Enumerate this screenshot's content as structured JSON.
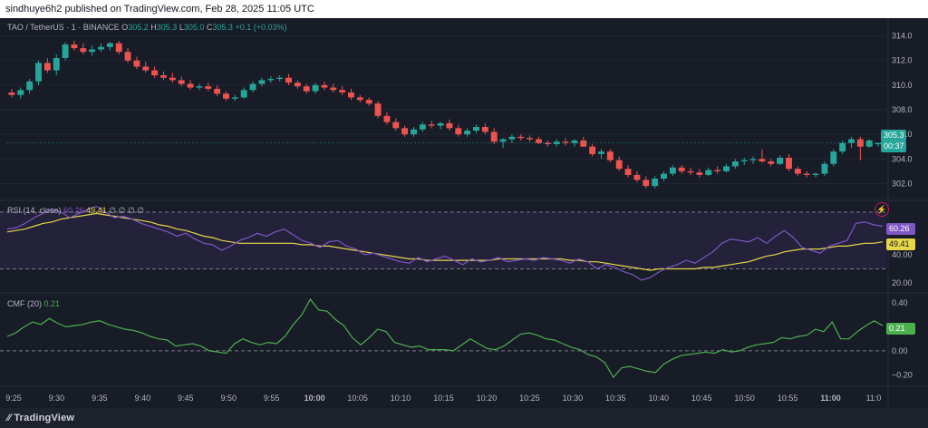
{
  "header": {
    "published_text": "sindhuye6h2 published on TradingView.com, Feb 28, 2025 11:05 UTC"
  },
  "legend": {
    "symbol": "TAO / TetherUS · 1 · BINANCE",
    "open_label": "O",
    "open": "305.2",
    "high_label": "H",
    "high": "305.3",
    "low_label": "L",
    "low": "305.0",
    "close_label": "C",
    "close": "305.3",
    "change": "+0.1 (+0.03%)"
  },
  "price_tags": {
    "price": "305.3",
    "countdown": "00:37"
  },
  "rsi_legend": {
    "label": "RSI (14, close)",
    "rsi": "60.26",
    "ma": "49.41",
    "extra": "∅ ∅ ∅ ∅"
  },
  "rsi_tags": {
    "rsi": "60.26",
    "ma": "49.41"
  },
  "cmf_legend": {
    "label": "CMF (20)",
    "value": "0.21"
  },
  "cmf_tag": {
    "value": "0.21"
  },
  "footer": {
    "brand": "TradingView"
  },
  "colors": {
    "up": "#26a69a",
    "down": "#ef5350",
    "rsi": "#7e57c2",
    "rsi_ma": "#e6d64a",
    "cmf": "#4caf50",
    "band": "#2a2445"
  },
  "chart_data": [
    {
      "type": "candlestick",
      "title": "TAO / TetherUS · 1 · BINANCE",
      "ylim": [
        301,
        315
      ],
      "yticks": [
        302.0,
        304.0,
        306.0,
        308.0,
        310.0,
        312.0,
        314.0
      ],
      "xticks": [
        "9:25",
        "9:30",
        "9:35",
        "9:40",
        "9:45",
        "9:50",
        "9:55",
        "10:00",
        "10:05",
        "10:10",
        "10:15",
        "10:20",
        "10:25",
        "10:30",
        "10:35",
        "10:40",
        "10:45",
        "10:50",
        "10:55",
        "11:00",
        "11:0"
      ],
      "candles": [
        [
          309.4,
          309.7,
          309.0,
          309.2
        ],
        [
          309.2,
          309.8,
          308.9,
          309.6
        ],
        [
          309.6,
          310.5,
          309.3,
          310.3
        ],
        [
          310.3,
          312.0,
          310.0,
          311.8
        ],
        [
          311.8,
          312.2,
          311.0,
          311.2
        ],
        [
          311.2,
          312.5,
          310.8,
          312.2
        ],
        [
          312.2,
          313.5,
          312.0,
          313.3
        ],
        [
          313.3,
          313.6,
          312.8,
          313.0
        ],
        [
          313.0,
          313.4,
          312.5,
          312.7
        ],
        [
          312.7,
          313.2,
          312.4,
          312.9
        ],
        [
          312.9,
          313.4,
          312.7,
          313.1
        ],
        [
          313.1,
          313.5,
          312.8,
          313.4
        ],
        [
          313.4,
          313.6,
          312.5,
          312.7
        ],
        [
          312.7,
          313.0,
          311.8,
          312.0
        ],
        [
          312.0,
          312.3,
          311.3,
          311.5
        ],
        [
          311.5,
          311.9,
          311.0,
          311.2
        ],
        [
          311.2,
          311.5,
          310.6,
          310.8
        ],
        [
          310.8,
          311.1,
          310.4,
          310.6
        ],
        [
          310.6,
          311.0,
          310.2,
          310.4
        ],
        [
          310.4,
          310.7,
          309.9,
          310.1
        ],
        [
          310.1,
          310.4,
          309.6,
          309.8
        ],
        [
          309.8,
          310.1,
          309.6,
          309.9
        ],
        [
          309.9,
          310.2,
          309.5,
          309.7
        ],
        [
          309.7,
          310.0,
          309.1,
          309.3
        ],
        [
          309.3,
          309.5,
          308.7,
          308.9
        ],
        [
          308.9,
          309.2,
          308.7,
          309.0
        ],
        [
          309.0,
          309.8,
          308.9,
          309.6
        ],
        [
          309.6,
          310.3,
          309.4,
          310.1
        ],
        [
          310.1,
          310.6,
          309.9,
          310.4
        ],
        [
          310.4,
          310.7,
          310.2,
          310.5
        ],
        [
          310.5,
          310.8,
          310.3,
          310.6
        ],
        [
          310.6,
          310.9,
          310.0,
          310.2
        ],
        [
          310.2,
          310.4,
          309.7,
          309.9
        ],
        [
          309.9,
          310.1,
          309.3,
          309.5
        ],
        [
          309.5,
          310.2,
          309.3,
          310.0
        ],
        [
          310.0,
          310.3,
          309.6,
          309.8
        ],
        [
          309.8,
          310.1,
          309.4,
          309.6
        ],
        [
          309.6,
          309.9,
          309.2,
          309.4
        ],
        [
          309.4,
          309.7,
          308.8,
          309.0
        ],
        [
          309.0,
          309.2,
          308.6,
          308.8
        ],
        [
          308.8,
          309.0,
          308.3,
          308.5
        ],
        [
          308.5,
          308.7,
          307.3,
          307.5
        ],
        [
          307.5,
          307.8,
          306.8,
          307.0
        ],
        [
          307.0,
          307.3,
          306.3,
          306.5
        ],
        [
          306.5,
          306.7,
          305.8,
          306.0
        ],
        [
          306.0,
          306.6,
          305.8,
          306.4
        ],
        [
          306.4,
          307.0,
          306.2,
          306.8
        ],
        [
          306.8,
          307.1,
          306.5,
          306.7
        ],
        [
          306.7,
          307.0,
          306.4,
          306.9
        ],
        [
          306.9,
          307.2,
          306.3,
          306.5
        ],
        [
          306.5,
          306.8,
          305.8,
          306.0
        ],
        [
          306.0,
          306.5,
          305.8,
          306.3
        ],
        [
          306.3,
          306.8,
          306.1,
          306.6
        ],
        [
          306.6,
          306.9,
          306.0,
          306.2
        ],
        [
          306.2,
          306.5,
          305.2,
          305.4
        ],
        [
          305.4,
          305.7,
          304.9,
          305.6
        ],
        [
          305.6,
          306.0,
          305.3,
          305.8
        ],
        [
          305.8,
          306.0,
          305.5,
          305.7
        ],
        [
          305.7,
          305.9,
          305.4,
          305.6
        ],
        [
          305.6,
          305.8,
          305.2,
          305.3
        ],
        [
          305.3,
          305.5,
          305.0,
          305.2
        ],
        [
          305.2,
          305.6,
          305.0,
          305.4
        ],
        [
          305.4,
          305.7,
          305.1,
          305.3
        ],
        [
          305.3,
          305.6,
          305.0,
          305.5
        ],
        [
          305.5,
          305.8,
          305.2,
          305.0
        ],
        [
          305.0,
          305.2,
          304.2,
          304.4
        ],
        [
          304.4,
          304.8,
          304.0,
          304.6
        ],
        [
          304.6,
          304.8,
          303.7,
          303.9
        ],
        [
          303.9,
          304.2,
          303.0,
          303.2
        ],
        [
          303.2,
          303.5,
          302.5,
          302.7
        ],
        [
          302.7,
          303.0,
          302.1,
          302.3
        ],
        [
          302.3,
          302.6,
          301.6,
          301.8
        ],
        [
          301.8,
          302.6,
          301.6,
          302.4
        ],
        [
          302.4,
          303.0,
          302.2,
          302.8
        ],
        [
          302.8,
          303.5,
          302.6,
          303.3
        ],
        [
          303.3,
          303.5,
          302.8,
          303.0
        ],
        [
          303.0,
          303.3,
          302.7,
          302.9
        ],
        [
          302.9,
          303.2,
          302.5,
          302.7
        ],
        [
          302.7,
          303.3,
          302.6,
          303.1
        ],
        [
          303.1,
          303.4,
          302.8,
          303.0
        ],
        [
          303.0,
          303.6,
          302.9,
          303.4
        ],
        [
          303.4,
          304.0,
          303.2,
          303.8
        ],
        [
          303.8,
          304.1,
          303.5,
          303.9
        ],
        [
          303.9,
          304.2,
          303.6,
          304.0
        ],
        [
          304.0,
          304.8,
          303.7,
          303.8
        ],
        [
          303.8,
          304.0,
          303.4,
          303.6
        ],
        [
          303.6,
          304.3,
          303.5,
          304.1
        ],
        [
          304.1,
          304.4,
          303.0,
          303.2
        ],
        [
          303.2,
          303.4,
          302.6,
          302.8
        ],
        [
          302.8,
          303.0,
          302.5,
          302.7
        ],
        [
          302.7,
          302.9,
          302.5,
          302.8
        ],
        [
          302.8,
          303.8,
          302.6,
          303.6
        ],
        [
          303.6,
          304.8,
          303.4,
          304.6
        ],
        [
          304.6,
          305.5,
          304.4,
          305.3
        ],
        [
          305.3,
          305.8,
          304.9,
          305.6
        ],
        [
          305.6,
          305.8,
          303.9,
          305.0
        ],
        [
          305.0,
          305.6,
          304.9,
          305.5
        ],
        [
          305.2,
          305.3,
          305.0,
          305.3
        ]
      ]
    },
    {
      "type": "line",
      "title": "RSI (14, close)",
      "ylim": [
        15,
        75
      ],
      "yticks": [
        20.0,
        40.0,
        60.0
      ],
      "band": [
        30,
        70
      ],
      "series": [
        {
          "name": "RSI",
          "values": [
            58,
            59,
            62,
            66,
            69,
            72,
            70,
            66,
            69,
            72,
            74,
            70,
            66,
            67,
            65,
            62,
            60,
            58,
            56,
            53,
            55,
            51,
            48,
            47,
            43,
            46,
            50,
            52,
            55,
            53,
            56,
            58,
            54,
            50,
            48,
            45,
            49,
            50,
            46,
            44,
            40,
            41,
            39,
            37,
            35,
            34,
            38,
            35,
            37,
            39,
            36,
            33,
            37,
            35,
            36,
            38,
            35,
            36,
            37,
            36,
            38,
            37,
            36,
            34,
            37,
            35,
            30,
            33,
            31,
            28,
            26,
            22,
            24,
            28,
            31,
            33,
            36,
            34,
            38,
            42,
            48,
            51,
            50,
            49,
            52,
            48,
            53,
            57,
            52,
            45,
            43,
            41,
            46,
            48,
            50,
            62,
            63,
            61,
            60
          ]
        },
        {
          "name": "MA",
          "values": [
            56,
            57,
            58,
            60,
            62,
            63,
            65,
            66,
            67,
            68,
            69,
            68,
            67,
            66,
            65,
            64,
            63,
            61,
            60,
            58,
            57,
            55,
            53,
            52,
            50,
            49,
            48,
            48,
            48,
            48,
            48,
            48,
            48,
            47,
            47,
            46,
            46,
            45,
            44,
            43,
            42,
            41,
            40,
            39,
            38,
            37,
            37,
            36,
            36,
            36,
            36,
            36,
            36,
            36,
            36,
            37,
            37,
            37,
            37,
            37,
            37,
            37,
            37,
            36,
            36,
            35,
            35,
            34,
            33,
            32,
            31,
            30,
            29,
            30,
            30,
            30,
            30,
            30,
            31,
            31,
            32,
            33,
            34,
            35,
            37,
            39,
            40,
            42,
            43,
            44,
            44,
            44,
            45,
            46,
            46,
            47,
            48,
            48,
            49
          ]
        }
      ]
    },
    {
      "type": "line",
      "title": "CMF (20)",
      "ylim": [
        -0.28,
        0.46
      ],
      "yticks": [
        -0.2,
        0.0,
        0.2,
        0.4
      ],
      "series": [
        {
          "name": "CMF",
          "values": [
            0.12,
            0.15,
            0.2,
            0.24,
            0.22,
            0.27,
            0.23,
            0.2,
            0.21,
            0.22,
            0.24,
            0.25,
            0.22,
            0.2,
            0.18,
            0.17,
            0.15,
            0.12,
            0.1,
            0.09,
            0.04,
            0.05,
            0.06,
            0.04,
            0.0,
            -0.01,
            -0.02,
            0.06,
            0.1,
            0.07,
            0.05,
            0.07,
            0.06,
            0.12,
            0.22,
            0.3,
            0.43,
            0.34,
            0.33,
            0.26,
            0.21,
            0.11,
            0.05,
            0.11,
            0.18,
            0.16,
            0.07,
            0.05,
            0.03,
            0.04,
            0.01,
            0.01,
            0.01,
            0.0,
            0.05,
            0.1,
            0.06,
            0.02,
            0.01,
            0.04,
            0.09,
            0.14,
            0.15,
            0.13,
            0.1,
            0.09,
            0.06,
            0.03,
            0.01,
            -0.03,
            -0.05,
            -0.1,
            -0.22,
            -0.14,
            -0.13,
            -0.15,
            -0.17,
            -0.18,
            -0.11,
            -0.07,
            -0.04,
            -0.03,
            -0.02,
            -0.01,
            -0.02,
            0.01,
            -0.01,
            0.0,
            0.03,
            0.05,
            0.06,
            0.07,
            0.11,
            0.1,
            0.12,
            0.13,
            0.18,
            0.16,
            0.24,
            0.1,
            0.1,
            0.16,
            0.21,
            0.25,
            0.21
          ]
        }
      ]
    }
  ]
}
